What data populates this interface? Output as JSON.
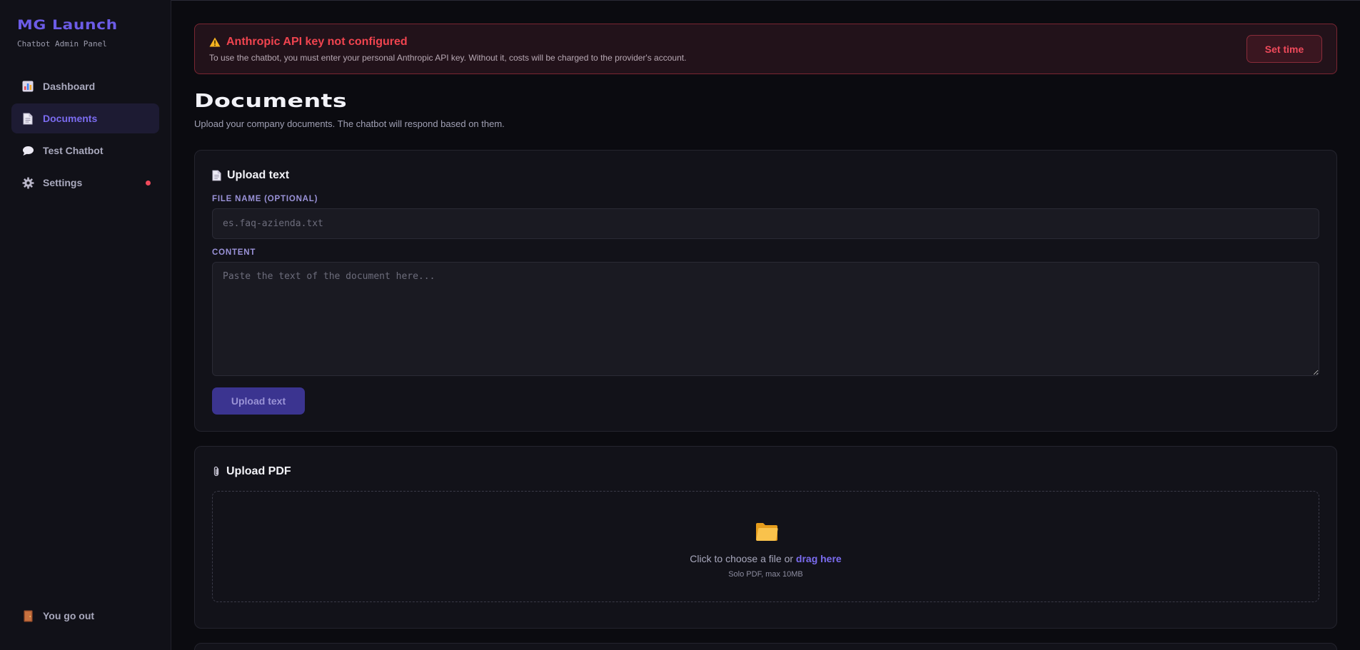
{
  "sidebar": {
    "brand": "MG Launch",
    "subtitle": "Chatbot Admin Panel",
    "items": [
      {
        "label": "Dashboard",
        "icon": "bar-chart-icon"
      },
      {
        "label": "Documents",
        "icon": "document-icon",
        "active": true
      },
      {
        "label": "Test Chatbot",
        "icon": "speech-bubble-icon"
      },
      {
        "label": "Settings",
        "icon": "gear-icon",
        "notification": true
      }
    ],
    "logout": {
      "label": "You go out",
      "icon": "door-icon"
    }
  },
  "alert": {
    "title": "Anthropic API key not configured",
    "text": "To use the chatbot, you must enter your personal Anthropic API key. Without it, costs will be charged to the provider's account.",
    "button": "Set time",
    "icon": "warning-icon"
  },
  "page": {
    "title": "Documents",
    "subtitle": "Upload your company documents. The chatbot will respond based on them."
  },
  "upload_text": {
    "title": "Upload text",
    "icon": "document-icon",
    "file_name_label": "FILE NAME (OPTIONAL)",
    "file_name_placeholder": "es.faq-azienda.txt",
    "file_name_value": "",
    "content_label": "CONTENT",
    "content_placeholder": "Paste the text of the document here...",
    "content_value": "",
    "button": "Upload text"
  },
  "upload_pdf": {
    "title": "Upload PDF",
    "icon": "paperclip-icon",
    "prompt": "Click to choose a file or ",
    "link": "drag here",
    "hint": "Solo PDF, max 10MB",
    "dropzone_icon": "folder-icon"
  },
  "colors": {
    "accent": "#6c5ce7",
    "danger": "#ef4a5b",
    "background": "#0b0b10",
    "sidebar": "#111118",
    "card": "#121219"
  }
}
